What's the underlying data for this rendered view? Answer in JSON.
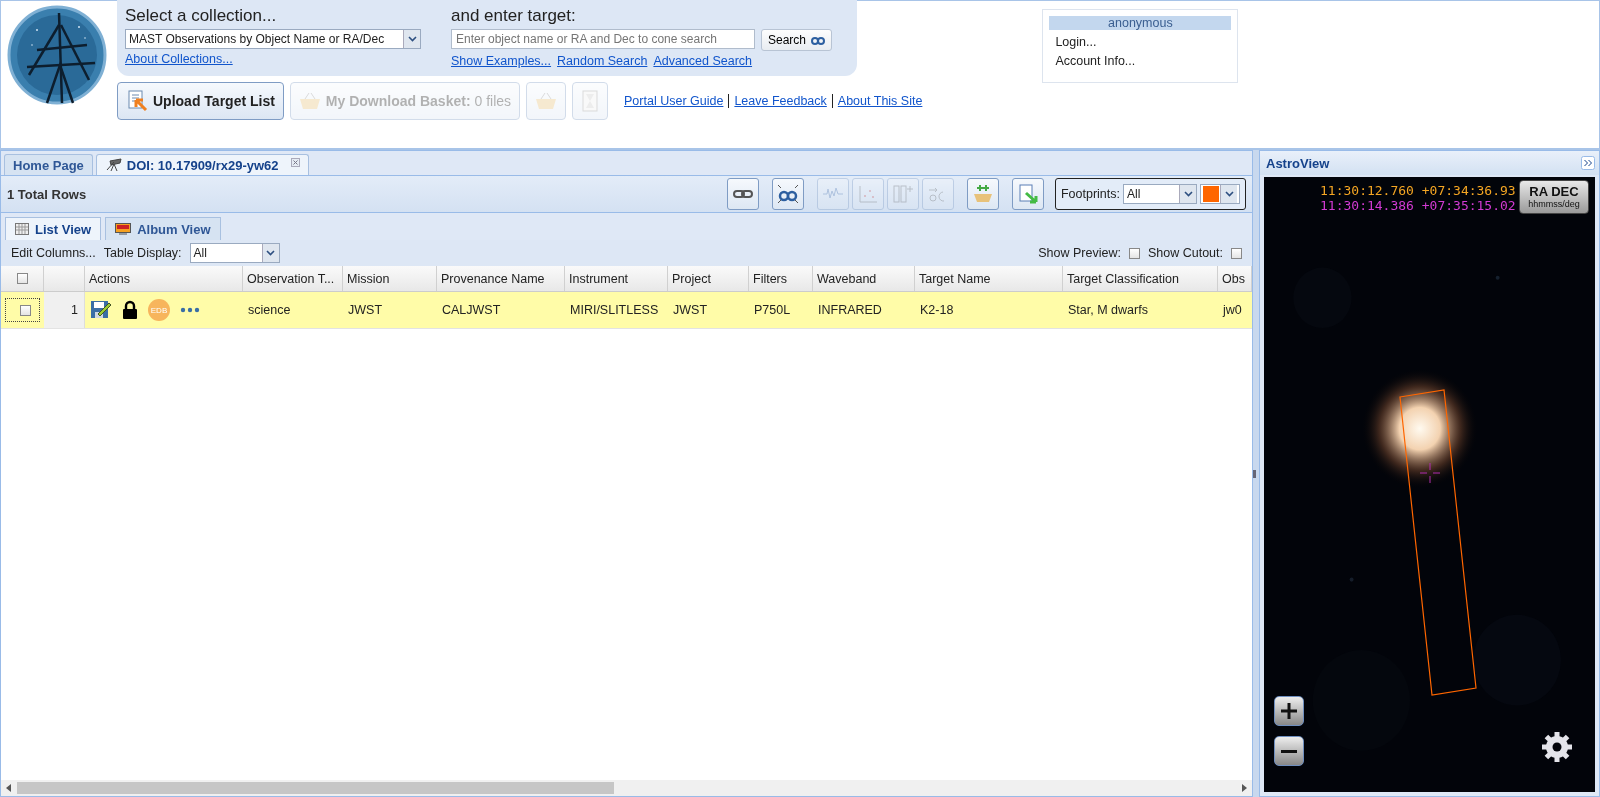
{
  "search_panel": {
    "collection_label": "Select a collection...",
    "collection_value": "MAST Observations by Object Name or RA/Dec",
    "about_link": "About Collections...",
    "target_label": "and enter target:",
    "target_placeholder": "Enter object name or RA and Dec to cone search",
    "search_button": "Search",
    "links": [
      "Show Examples...",
      "Random Search",
      "Advanced Search"
    ]
  },
  "header_buttons": [
    {
      "kind": "upload",
      "label": "Upload Target List",
      "disabled": false
    },
    {
      "kind": "basket",
      "label": "**My Download Basket:** 0 files",
      "disabled": true
    },
    {
      "kind": "basket-icon",
      "disabled": true
    },
    {
      "kind": "hourglass",
      "disabled": true
    }
  ],
  "help_links": [
    "Portal User Guide",
    "Leave Feedback",
    "About This Site"
  ],
  "user_menu": {
    "user": "anonymous",
    "items": [
      "Login...",
      "Account Info..."
    ]
  },
  "tabs": [
    {
      "label": "Home Page",
      "selected": false,
      "closable": false
    },
    {
      "label": "DOI: 10.17909/rx29-yw62",
      "selected": true,
      "closable": true
    }
  ],
  "total_rows": "1 Total Rows",
  "toolbar": [
    {
      "kind": "link",
      "disabled": false
    },
    {
      "kind": "zoom",
      "disabled": false
    },
    {
      "kind": "spectrum",
      "disabled": true
    },
    {
      "kind": "scatter",
      "disabled": true
    },
    {
      "kind": "columns",
      "disabled": true
    },
    {
      "kind": "coords",
      "disabled": true
    },
    {
      "kind": "basket-add",
      "disabled": false
    },
    {
      "kind": "export",
      "disabled": false
    }
  ],
  "footprints": {
    "label": "Footprints:",
    "value": "All",
    "color": "#ff6600"
  },
  "view_tabs": [
    {
      "label": "List View",
      "kind": "list",
      "selected": true
    },
    {
      "label": "Album View",
      "kind": "album",
      "selected": false
    }
  ],
  "options": {
    "edit_columns": "Edit Columns...",
    "table_display_label": "Table Display:",
    "table_display_value": "All",
    "show_preview": {
      "label": "Show Preview:",
      "checked": false
    },
    "show_cutout": {
      "label": "Show Cutout:",
      "checked": false
    }
  },
  "table": {
    "select_all_checked": false,
    "actions_header": "Actions",
    "columns": [
      "Observation T...",
      "Mission",
      "Provenance Name",
      "Instrument",
      "Project",
      "Filters",
      "Waveband",
      "Target Name",
      "Target Classification",
      "Obs"
    ],
    "rows": [
      {
        "selected": true,
        "checked": false,
        "number": "1",
        "edb": "EDB",
        "cells": [
          "science",
          "JWST",
          "CALJWST",
          "MIRI/SLITLESS",
          "JWST",
          "P750L",
          "INFRARED",
          "K2-18",
          "Star, M dwarfs",
          "jw0"
        ]
      }
    ]
  },
  "astroview": {
    "title": "AstroView",
    "coordinates": [
      {
        "text": "11:30:12.760 +07:34:36.93",
        "color": "#f5a623"
      },
      {
        "text": "11:30:14.386 +07:35:15.02",
        "color": "#d23ad2"
      }
    ],
    "format_button": {
      "label": "RA DEC",
      "sub": "hhmmss/deg"
    }
  }
}
